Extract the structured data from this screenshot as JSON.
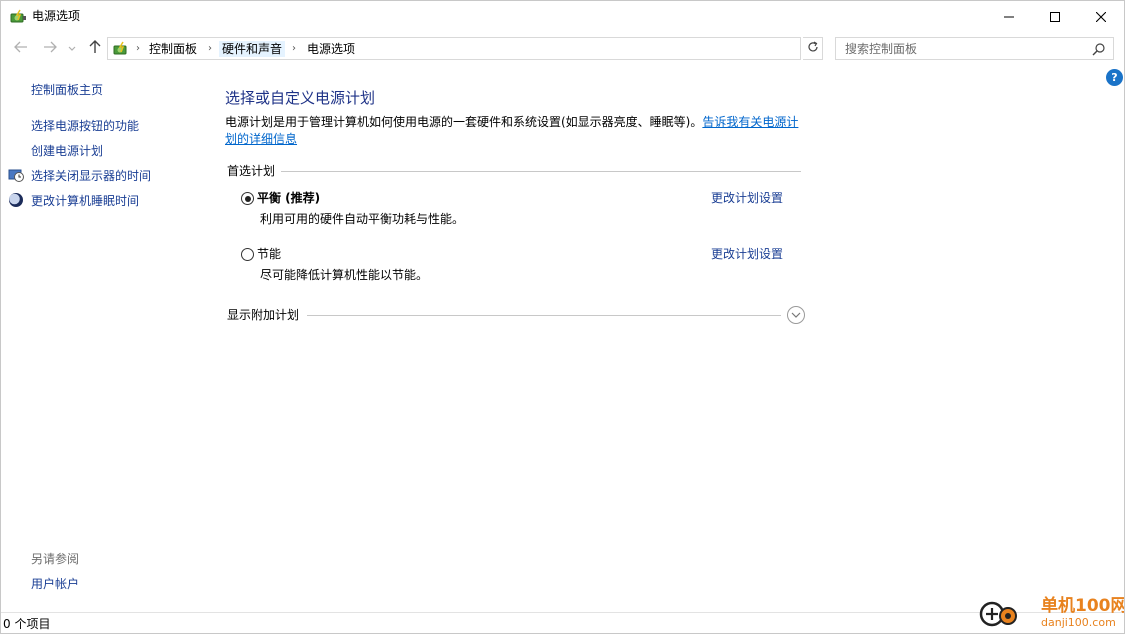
{
  "window": {
    "title": "电源选项",
    "icon": "power-options-icon"
  },
  "address": {
    "crumbs": [
      "控制面板",
      "硬件和声音",
      "电源选项"
    ]
  },
  "search": {
    "placeholder": "搜索控制面板"
  },
  "sidebar": {
    "home": "控制面板主页",
    "items": [
      {
        "label": "选择电源按钮的功能",
        "icon": ""
      },
      {
        "label": "创建电源计划",
        "icon": ""
      },
      {
        "label": "选择关闭显示器的时间",
        "icon": "monitor-clock-icon"
      },
      {
        "label": "更改计算机睡眠时间",
        "icon": "moon-sleep-icon"
      }
    ],
    "see_also_label": "另请参阅",
    "see_also_items": [
      "用户帐户"
    ]
  },
  "main": {
    "title": "选择或自定义电源计划",
    "intro": "电源计划是用于管理计算机如何使用电源的一套硬件和系统设置(如显示器亮度、睡眠等)。",
    "intro_link": "告诉我有关电源计划的详细信息",
    "preferred_label": "首选计划",
    "plans": [
      {
        "name": "平衡 (推荐)",
        "desc": "利用可用的硬件自动平衡功耗与性能。",
        "link": "更改计划设置",
        "selected": true
      },
      {
        "name": "节能",
        "desc": "尽可能降低计算机性能以节能。",
        "link": "更改计划设置",
        "selected": false
      }
    ],
    "extra_label": "显示附加计划"
  },
  "statusbar": {
    "text": "0 个项目"
  },
  "watermark": {
    "name": "单机100网",
    "url": "danji100.com"
  },
  "colors": {
    "link": "#1a3e94",
    "title": "#1e3287",
    "help": "#1a73c8",
    "watermark": "#e8821e"
  }
}
